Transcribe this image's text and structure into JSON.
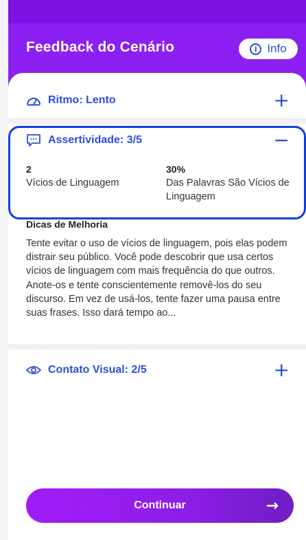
{
  "header": {
    "title": "Feedback do Cenário",
    "info_label": "Info",
    "info_icon": "info-icon"
  },
  "sections": {
    "ritmo": {
      "label": "Ritmo: Lento",
      "icon": "speedometer-icon",
      "toggle": "+"
    },
    "assertividade": {
      "label": "Assertividade: 3/5",
      "icon": "chat-bubble-icon",
      "toggle": "−",
      "stats": [
        {
          "value": "2",
          "label": "Vícios de Linguagem"
        },
        {
          "value": "30%",
          "label": "Das Palavras São Vícios de Linguagem"
        }
      ],
      "tips_title": "Dicas de Melhoria",
      "tips_body": "Tente evitar o uso de vícios de linguagem, pois elas podem distrair seu público. Você pode descobrir que usa certos vícios de linguagem com mais frequência do que outros. Anote-os e tente conscientemente removê-los do seu discurso. Em vez de usá-los, tente fazer uma pausa entre suas frases. Isso dará tempo ao..."
    },
    "contato": {
      "label": "Contato Visual:  2/5",
      "icon": "eye-icon",
      "toggle": "+"
    }
  },
  "footer": {
    "continue_label": "Continuar",
    "arrow": "→"
  },
  "colors": {
    "primary_purple": "#8a1ef0",
    "accent_blue": "#2a4fd6",
    "highlight_blue": "#0f3fe0"
  }
}
